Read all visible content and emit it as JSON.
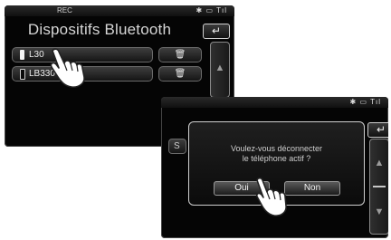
{
  "screen1": {
    "status_label": "REC",
    "status_icons": "✱ ▭ Tıl",
    "title": "Dispositifs Bluetooth",
    "back_icon": "↵",
    "devices": [
      {
        "name": "L30",
        "icon": "phone-icon-white"
      },
      {
        "name": "LB330",
        "icon": "phone-icon-black"
      }
    ],
    "delete_icon": "🗑",
    "scroll_up_icon": "▲"
  },
  "screen2": {
    "status_icons": "✱ ▭ Tıl",
    "back_icon": "↵",
    "under_row_label": "S",
    "dialog": {
      "message_line1": "Voulez-vous déconnecter",
      "message_line2": "le téléphone actif ?",
      "yes_label": "Oui",
      "no_label": "Non"
    },
    "scroll_up_icon": "▲",
    "scroll_down_icon": "▼"
  }
}
